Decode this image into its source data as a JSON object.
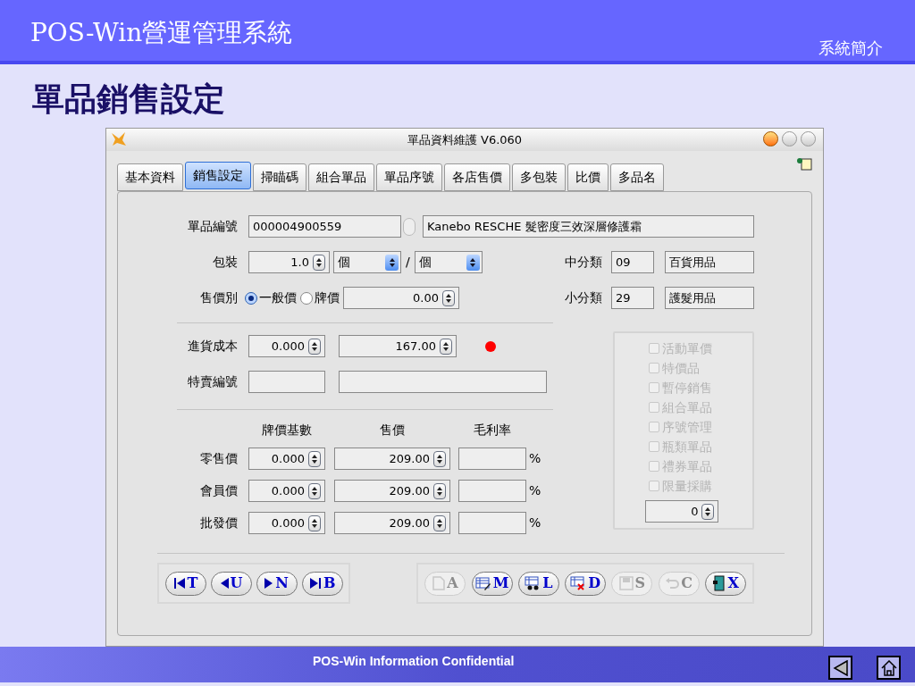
{
  "slide": {
    "title": "POS-Win營運管理系統",
    "section": "系統簡介",
    "heading": "單品銷售設定",
    "footer": "POS-Win Information Confidential"
  },
  "window": {
    "title": "單品資料維護 V6.060"
  },
  "tabs": [
    {
      "label": "基本資料",
      "selected": false
    },
    {
      "label": "銷售設定",
      "selected": true
    },
    {
      "label": "掃瞄碼",
      "selected": false
    },
    {
      "label": "組合單品",
      "selected": false
    },
    {
      "label": "單品序號",
      "selected": false
    },
    {
      "label": "各店售價",
      "selected": false
    },
    {
      "label": "多包裝",
      "selected": false
    },
    {
      "label": "比價",
      "selected": false
    },
    {
      "label": "多品名",
      "selected": false
    }
  ],
  "item": {
    "code_label": "單品編號",
    "code": "000004900559",
    "name": "Kanebo RESCHE 髮密度三效深層修護霜"
  },
  "packing": {
    "label": "包裝",
    "quantity": "1.0",
    "unit": "個",
    "separator": "/",
    "per_unit": "個"
  },
  "category": [
    {
      "label": "中分類",
      "code": "09",
      "name": "百貨用品"
    },
    {
      "label": "小分類",
      "code": "29",
      "name": "護髮用品"
    }
  ],
  "price_type": {
    "label": "售價別",
    "options": [
      {
        "label": "一般價",
        "selected": true
      },
      {
        "label": "牌價",
        "selected": false
      }
    ],
    "value": "0.00"
  },
  "cost": {
    "label": "進貨成本",
    "base": "0.000",
    "value": "167.00"
  },
  "special": {
    "label": "特賣編號"
  },
  "price_table": {
    "columns": [
      "牌價基數",
      "售價",
      "毛利率"
    ],
    "rows": [
      {
        "label": "零售價",
        "base": "0.000",
        "price": "209.00",
        "unit": "%"
      },
      {
        "label": "會員價",
        "base": "0.000",
        "price": "209.00",
        "unit": "%"
      },
      {
        "label": "批發價",
        "base": "0.000",
        "price": "209.00",
        "unit": "%"
      }
    ]
  },
  "flags": [
    {
      "label": "活動單價",
      "checked": false,
      "disabled": true
    },
    {
      "label": "特價品",
      "checked": false,
      "disabled": true
    },
    {
      "label": "暫停銷售",
      "checked": false,
      "disabled": true
    },
    {
      "label": "組合單品",
      "checked": false,
      "disabled": true
    },
    {
      "label": "序號管理",
      "checked": false,
      "disabled": true
    },
    {
      "label": "瓶類單品",
      "checked": false,
      "disabled": true
    },
    {
      "label": "禮券單品",
      "checked": false,
      "disabled": true
    },
    {
      "label": "限量採購",
      "checked": false,
      "disabled": true
    }
  ],
  "limit": {
    "value": "0"
  },
  "nav_buttons": [
    {
      "key": "T",
      "kind": "first"
    },
    {
      "key": "U",
      "kind": "prev"
    },
    {
      "key": "N",
      "kind": "next"
    },
    {
      "key": "B",
      "kind": "last"
    }
  ],
  "action_buttons": [
    {
      "key": "A",
      "kind": "add",
      "disabled": true
    },
    {
      "key": "M",
      "kind": "edit",
      "disabled": false
    },
    {
      "key": "L",
      "kind": "find",
      "disabled": false
    },
    {
      "key": "D",
      "kind": "delete",
      "disabled": false
    },
    {
      "key": "S",
      "kind": "save",
      "disabled": true
    },
    {
      "key": "C",
      "kind": "undo",
      "disabled": true
    },
    {
      "key": "X",
      "kind": "exit",
      "disabled": false
    }
  ]
}
